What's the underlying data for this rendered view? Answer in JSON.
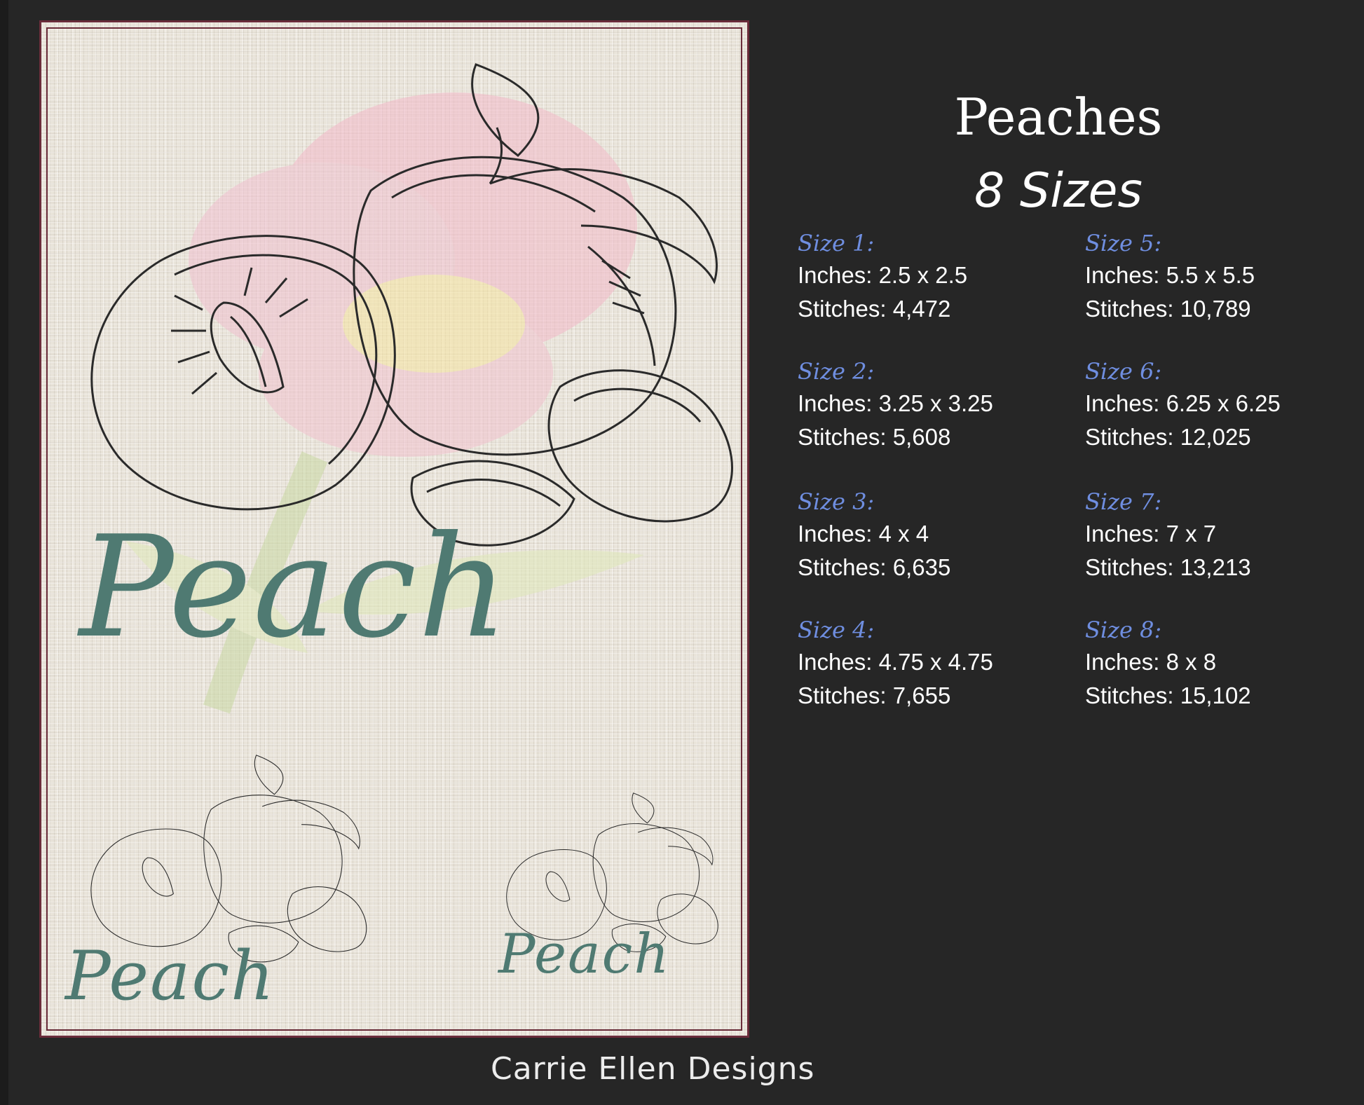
{
  "title": "Peaches",
  "subtitle": "8 Sizes",
  "brand": "Carrie Ellen Designs",
  "preview": {
    "word_large": "Peach",
    "word_medium": "Peach",
    "word_small": "Peach"
  },
  "sizes": [
    {
      "heading": "Size 1:",
      "inches": "Inches: 2.5 x 2.5",
      "stitches": "Stitches: 4,472"
    },
    {
      "heading": "Size 2:",
      "inches": "Inches: 3.25 x 3.25",
      "stitches": "Stitches: 5,608"
    },
    {
      "heading": "Size 3:",
      "inches": "Inches: 4 x 4",
      "stitches": "Stitches: 6,635"
    },
    {
      "heading": "Size 4:",
      "inches": "Inches: 4.75 x 4.75",
      "stitches": "Stitches: 7,655"
    },
    {
      "heading": "Size 5:",
      "inches": "Inches: 5.5 x 5.5",
      "stitches": "Stitches: 10,789"
    },
    {
      "heading": "Size 6:",
      "inches": "Inches: 6.25 x 6.25",
      "stitches": "Stitches: 12,025"
    },
    {
      "heading": "Size 7:",
      "inches": "Inches: 7 x 7",
      "stitches": "Stitches: 13,213"
    },
    {
      "heading": "Size 8:",
      "inches": "Inches: 8 x 8",
      "stitches": "Stitches: 15,102"
    }
  ],
  "colors": {
    "background": "#262626",
    "heading": "#6f8ee0",
    "frame": "#6a2c3a",
    "lettering": "#4f7a72"
  }
}
